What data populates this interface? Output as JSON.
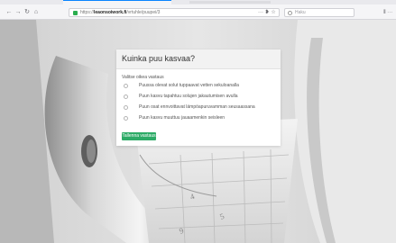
{
  "browser": {
    "url_prefix": "https://",
    "url_domain": "leaonsoiwork.fi",
    "url_path": "/vrtuhle/puupei/3",
    "search_placeholder": "Haku",
    "nav_back": "←",
    "nav_forward": "→",
    "nav_reload": "↻",
    "nav_home": "⌂",
    "url_actions": "··· ❥ ☆",
    "tool_icons": "⫴ ⋯"
  },
  "modal": {
    "title": "Kuinka puu kasvaa?",
    "prompt": "Valitse oikea vastaus",
    "options": [
      {
        "label": "Puussa olevat solut tuppaavat vetten sekuloanalla"
      },
      {
        "label": "Puun kasvu tapahtuu solujen jakautumisen avulla"
      },
      {
        "label": "Puun osat ennvoittavat lämpöapuruvamman seusaassana"
      },
      {
        "label": "Puun kasvu muuttuu jauaamenkin seisleen"
      }
    ],
    "submit_label": "Tallenna vastaus"
  },
  "colors": {
    "accent": "#2dab67",
    "page_background": "#d9d9d9"
  }
}
